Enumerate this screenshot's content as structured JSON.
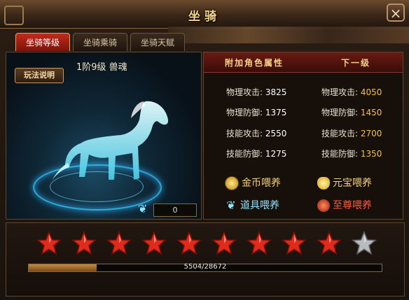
{
  "window": {
    "title": "坐骑",
    "close_label": "×"
  },
  "tabs": [
    {
      "label": "坐骑等级",
      "active": true
    },
    {
      "label": "坐骑乘骑",
      "active": false
    },
    {
      "label": "坐骑天赋",
      "active": false
    }
  ],
  "mount": {
    "name": "1阶9级   兽魂",
    "rules_button": "玩法说明",
    "counter_value": "0",
    "icons": {
      "wing": "wing-icon",
      "horse": "spirit-horse-image"
    }
  },
  "attributes": {
    "header_current": "附加角色属性",
    "header_next": "下一级",
    "rows": [
      {
        "label": "物理攻击:",
        "value": "3825",
        "next_label": "物理攻击:",
        "next_value": "4050"
      },
      {
        "label": "物理防御:",
        "value": "1375",
        "next_label": "物理防御:",
        "next_value": "1450"
      },
      {
        "label": "技能攻击:",
        "value": "2550",
        "next_label": "技能攻击:",
        "next_value": "2700"
      },
      {
        "label": "技能防御:",
        "value": "1275",
        "next_label": "技能防御:",
        "next_value": "1350"
      }
    ]
  },
  "feed": {
    "gold": "金币喂养",
    "yuanbao": "元宝喂养",
    "item": "道具喂养",
    "supreme": "至尊喂养"
  },
  "progress": {
    "stars_filled": 9,
    "stars_total": 10,
    "current": 5504,
    "max": 28672,
    "text": "5504/28672"
  },
  "colors": {
    "accent_gold": "#f3c33c",
    "tab_active": "#c22a1b",
    "star_red": "#e02a1a",
    "star_grey": "#b9bcbf"
  }
}
